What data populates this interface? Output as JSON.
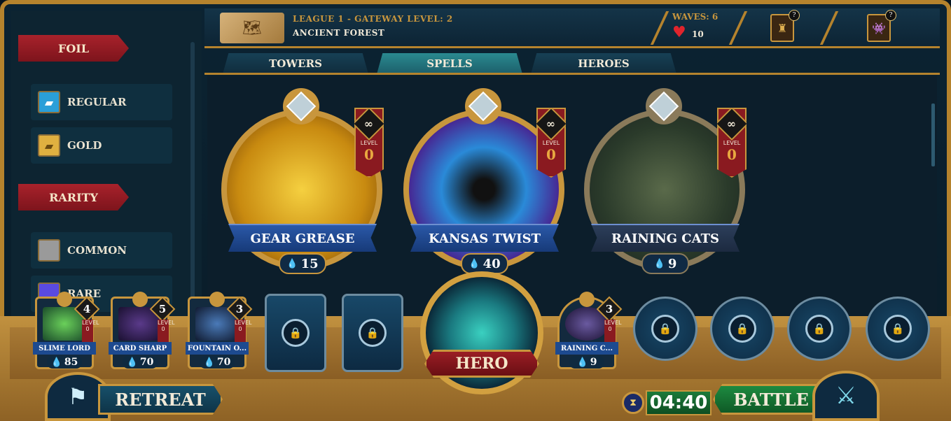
{
  "sidebar": {
    "foil_title": "FOIL",
    "foil_options": [
      {
        "label": "REGULAR",
        "icon": "regular-foil-icon",
        "color": "#2a9fd8"
      },
      {
        "label": "GOLD",
        "icon": "gold-foil-icon",
        "color": "#e0b040"
      }
    ],
    "rarity_title": "RARITY",
    "rarity_options": [
      {
        "label": "COMMON",
        "color": "#9a9a9a"
      },
      {
        "label": "RARE",
        "color": "#5a4ae0"
      }
    ]
  },
  "header": {
    "league": "LEAGUE 1 - GATEWAY LEVEL: 2",
    "location": "ANCIENT FOREST",
    "waves": "WAVES: 6",
    "lives": "10",
    "help_badge": "?"
  },
  "tabs": [
    "TOWERS",
    "SPELLS",
    "HEROES"
  ],
  "active_tab": "SPELLS",
  "spells": [
    {
      "name": "GEAR GREASE",
      "cost": "15",
      "level_label": "LEVEL",
      "level": "0",
      "infinity": "∞",
      "art": "#d6a020"
    },
    {
      "name": "KANSAS TWIST",
      "cost": "40",
      "level_label": "LEVEL",
      "level": "0",
      "infinity": "∞",
      "art": "#3a7ad8"
    },
    {
      "name": "RAINING CATS",
      "cost": "9",
      "level_label": "LEVEL",
      "level": "0",
      "infinity": "∞",
      "art": "#5a7a3a"
    }
  ],
  "deck": [
    {
      "name": "SLIME LORD",
      "cost": "85",
      "count": "4",
      "level_label": "LEVEL",
      "level": "0",
      "art": "#3aa04a"
    },
    {
      "name": "CARD SHARP",
      "cost": "70",
      "count": "5",
      "level_label": "LEVEL",
      "level": "0",
      "art": "#3a2a5a"
    },
    {
      "name": "FOUNTAIN O...",
      "cost": "70",
      "count": "3",
      "level_label": "LEVEL",
      "level": "0",
      "art": "#2a4a7a"
    },
    {
      "name": "RAINING C...",
      "cost": "9",
      "count": "3",
      "level_label": "LEVEL",
      "level": "0",
      "art": "#5a4a8a"
    }
  ],
  "hero_label": "HERO",
  "retreat_label": "RETREAT",
  "battle_label": "BATTLE",
  "timer": "04:40"
}
